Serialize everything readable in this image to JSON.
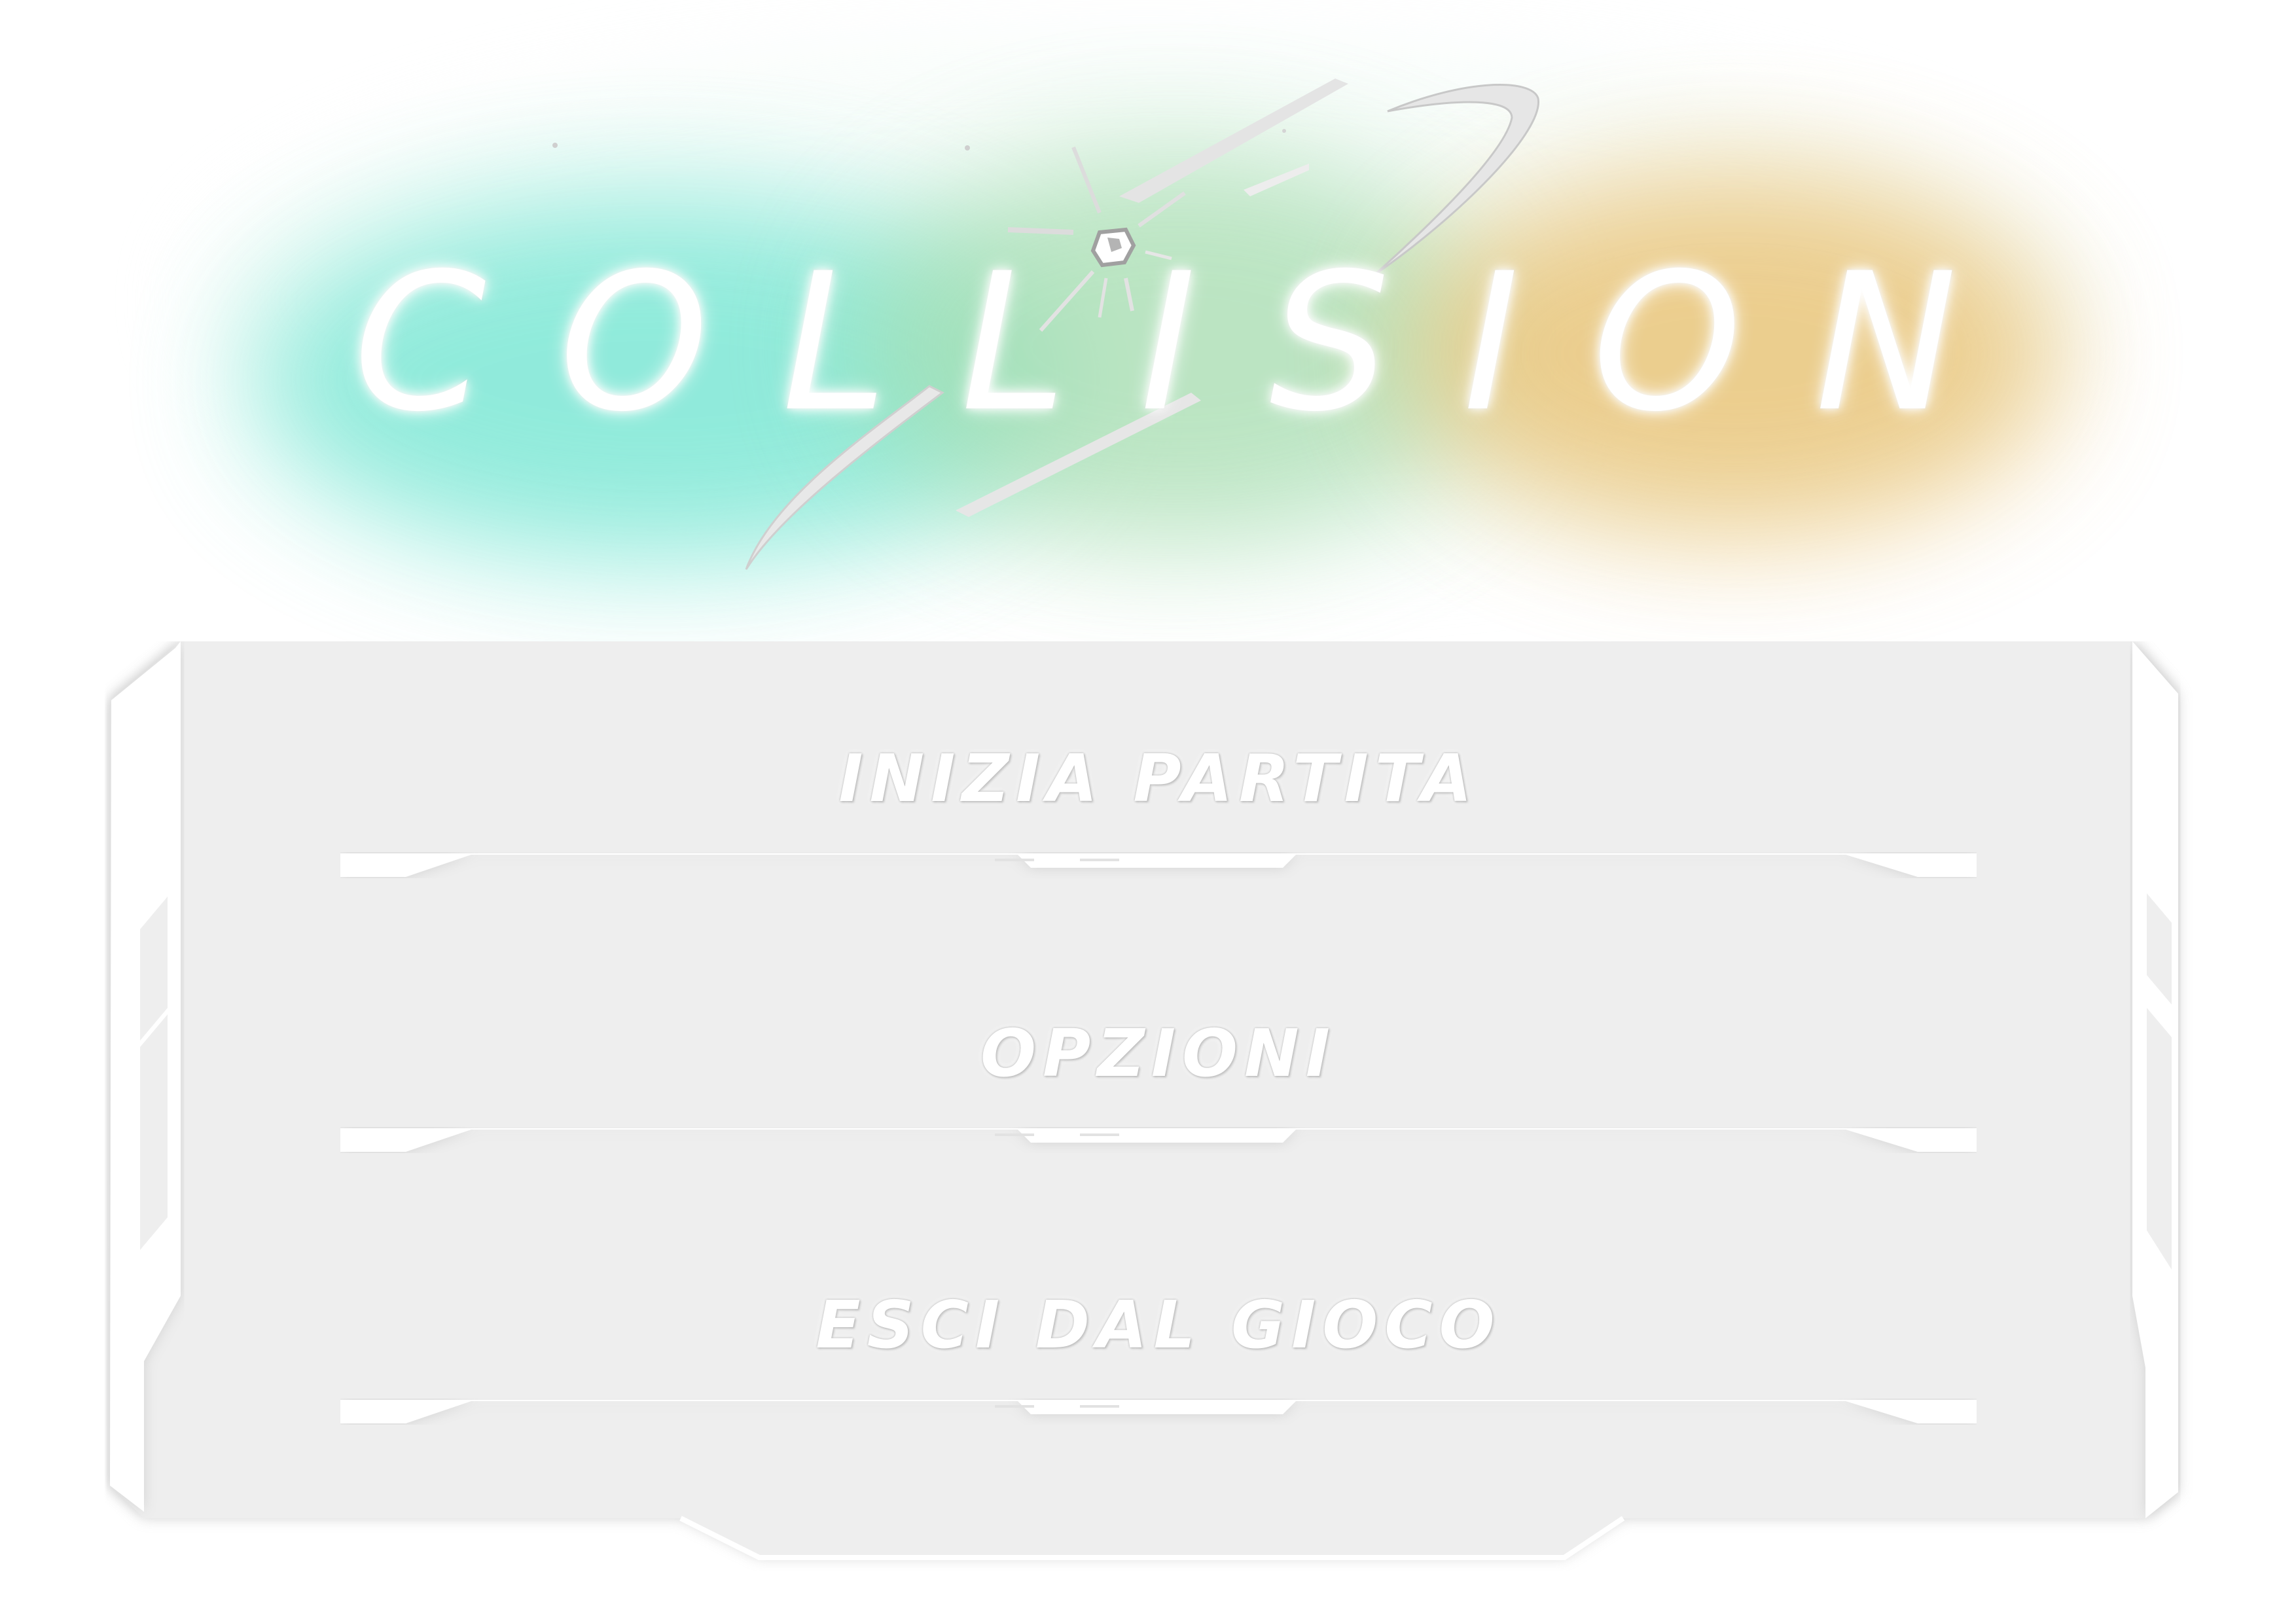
{
  "game": {
    "title": "COLLISION"
  },
  "menu": {
    "items": [
      {
        "label": "INIZIA PARTITA"
      },
      {
        "label": "OPZIONI"
      },
      {
        "label": "ESCI DAL GIOCO"
      }
    ]
  },
  "colors": {
    "glow_teal": "#7fe8d6",
    "glow_green": "#a7ddb0",
    "glow_orange": "#eac67c",
    "panel": "#eeeeee",
    "frame": "#ffffff",
    "text": "#ffffff"
  }
}
